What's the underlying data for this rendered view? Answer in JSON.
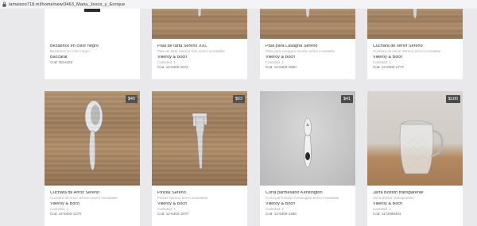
{
  "browser": {
    "url": "lamaison718.ml/home/new/3463_Maria_Jesús_y_Enrique"
  },
  "row1": [
    {
      "title": "Bezabrick en color negro",
      "subtitle": "Bezabrick en color negro",
      "brand": "Baccarat",
      "qty": "",
      "code": "Cod: 2814152"
    },
    {
      "title": "Pala de tarta Sereno XXL",
      "subtitle": "Pala de tarta Sereno XXL acero inoxidable",
      "brand": "Villeroy & Boch",
      "qty": "Cantidad: 1",
      "code": "Cod: 12-6402-1572"
    },
    {
      "title": "Pala para Lasagna Sereno",
      "subtitle": "Pala para Lasagna Sereno acero inoxidable",
      "brand": "Villeroy & Boch",
      "qty": "Cantidad: 1",
      "code": "Cod: 12-6402-1600"
    },
    {
      "title": "Cuchara de servir Sereno",
      "subtitle": "Cuchara de servir Sereno acero inoxidable",
      "brand": "Villeroy & Boch",
      "qty": "Cantidad: 1",
      "code": "Cod: 12-6402-1772"
    }
  ],
  "row2": [
    {
      "price": "$40",
      "title": "Cuchara de Arroz Sereno",
      "subtitle": "Cuchara de Arroz Sereno acero inoxidable",
      "brand": "Villeroy & Boch",
      "qty": "Cantidad: 1",
      "code": "Cod: 12-6402-1470"
    },
    {
      "price": "$63",
      "title": "Pinzas Sereno",
      "subtitle": "Pinzas Sereno acero inoxidable",
      "brand": "Villeroy & Boch",
      "qty": "Cantidad: 1",
      "code": "Cod: 12-6402-1570"
    },
    {
      "price": "$41",
      "title": "Corta parmesano Kensington",
      "subtitle": "Corta parmesano Kensington acero inoxidable",
      "brand": "Villeroy & Boch",
      "qty": "Cantidad: 1",
      "code": "Cod: 12-6400-1460"
    },
    {
      "price": "$100",
      "title": "Jarra Boston transparente",
      "subtitle": "Jarra Boston transparente",
      "brand": "Villeroy & Boch",
      "qty": "Cantidad: 1",
      "code": "Cod: 1172590401"
    }
  ],
  "colors": {
    "page_bg": "#e9e9ec",
    "card_bg": "#ffffff",
    "price_badge_bg": "#4a4a4a",
    "wood": "#a3825f"
  },
  "icons": {
    "lock": "lock-icon"
  }
}
